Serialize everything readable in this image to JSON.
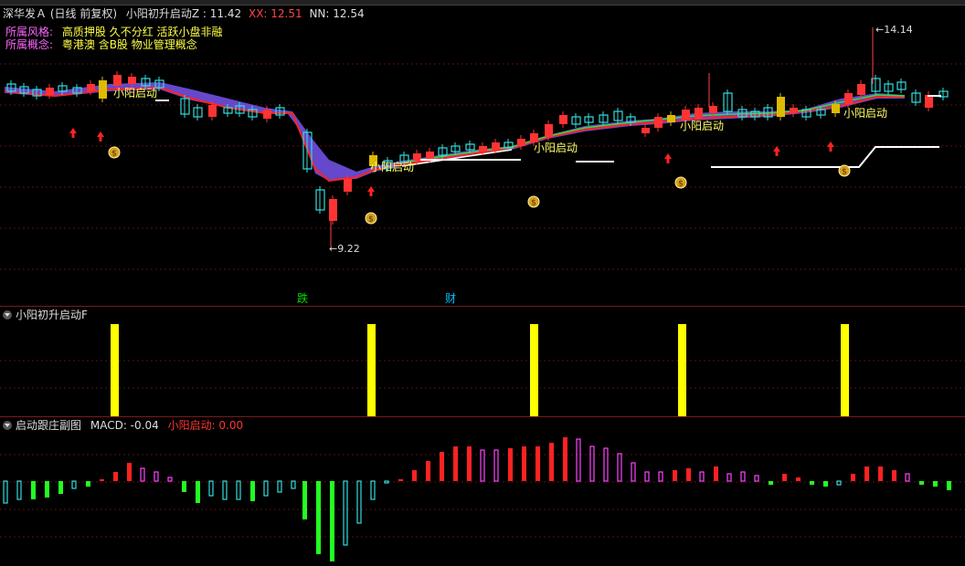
{
  "header": {
    "stock_name": "深华发Ａ",
    "period": "(日线 前复权)",
    "indicator_name": "小阳初升启动Z",
    "value_1": ": 11.42",
    "xx_label": "XX: 12.51",
    "nn_label": "NN: 12.54"
  },
  "info": {
    "style_label": "所属风格:",
    "style_value": "高质押股 久不分红 活跃小盘非融",
    "concept_label": "所属概念:",
    "concept_value": "粤港澳 含B股 物业管理概念"
  },
  "main_chart": {
    "price_high": "14.14",
    "price_low": "9.22",
    "signal_text": "小阳启动",
    "markers": [
      {
        "text": "跌",
        "color": "#00e000"
      },
      {
        "text": "财",
        "color": "#00c0ff"
      }
    ],
    "colors": {
      "up": "#ff3333",
      "down": "#33dddd",
      "signal": "#ffff66"
    }
  },
  "panel_f": {
    "title": "小阳初升启动F",
    "bar_color": "#ffff00"
  },
  "panel_macd": {
    "title": "启动跟庄副图",
    "macd_label": "MACD: -0.04",
    "signal_label": "小阳启动: 0.00"
  }
}
